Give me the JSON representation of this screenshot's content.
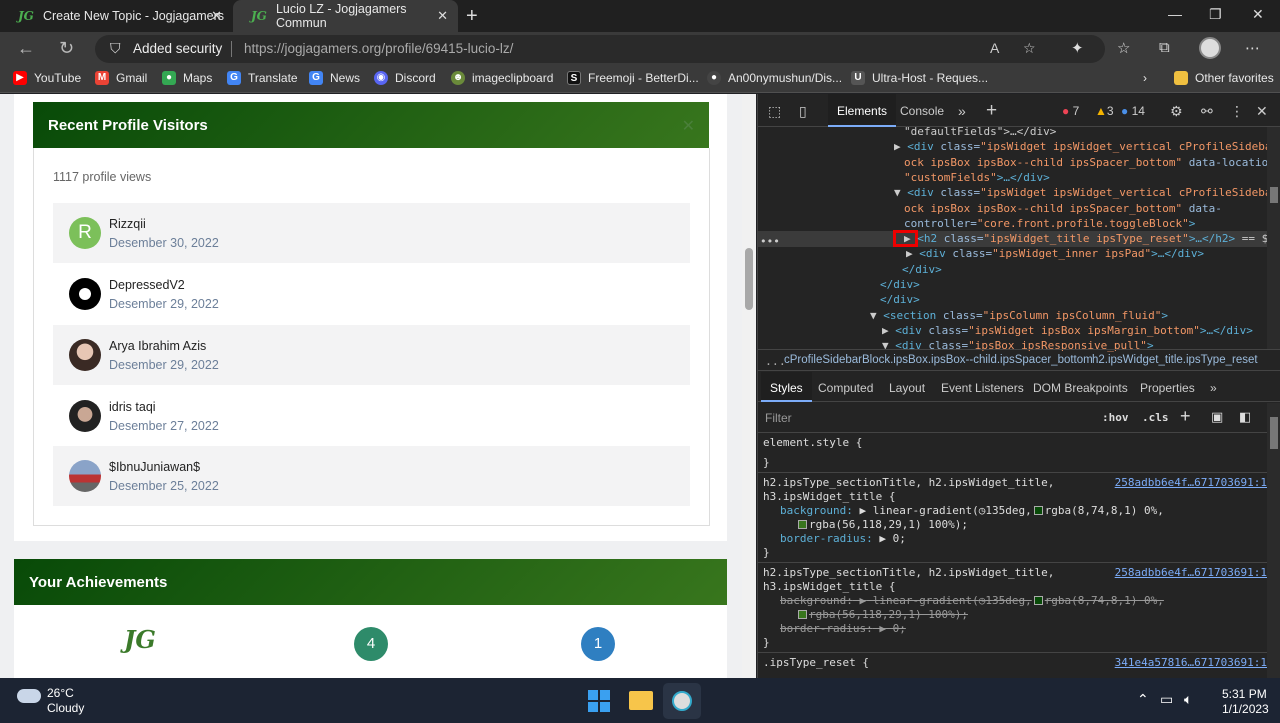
{
  "tabs": [
    {
      "favicon": "JG",
      "title": "Create New Topic - Jogjagamers"
    },
    {
      "favicon": "JG",
      "title": "Lucio LZ - Jogjagamers Commun"
    }
  ],
  "address_bar": {
    "security_label": "Added security",
    "url": "https://jogjagamers.org/profile/69415-lucio-lz/"
  },
  "bookmarks": [
    {
      "label": "YouTube",
      "color": "#ff0000"
    },
    {
      "label": "Gmail",
      "color": "#ea4335"
    },
    {
      "label": "Maps",
      "color": "#34a853"
    },
    {
      "label": "Translate",
      "color": "#4285f4"
    },
    {
      "label": "News",
      "color": "#4285f4"
    },
    {
      "label": "Discord",
      "color": "#5865f2"
    },
    {
      "label": "imageclipboard",
      "color": "#6a8a3a"
    },
    {
      "label": "Freemoji - BetterDi...",
      "color": "#111111"
    },
    {
      "label": "An00nymushun/Dis...",
      "color": "#444444"
    },
    {
      "label": "Ultra-Host - Reques...",
      "color": "#555555"
    }
  ],
  "bookmarks_other": "Other favorites",
  "visitors": {
    "title": "Recent Profile Visitors",
    "views": "1117 profile views",
    "items": [
      {
        "initial": "R",
        "name": "Rizzqii",
        "date": "Desember 30, 2022"
      },
      {
        "initial": "",
        "name": "DepressedV2",
        "date": "Desember 29, 2022"
      },
      {
        "initial": "",
        "name": "Arya Ibrahim Azis",
        "date": "Desember 29, 2022"
      },
      {
        "initial": "",
        "name": "idris taqi",
        "date": "Desember 27, 2022"
      },
      {
        "initial": "",
        "name": "$IbnuJuniawan$",
        "date": "Desember 25, 2022"
      }
    ]
  },
  "achievements": {
    "title": "Your Achievements",
    "logo": "JG",
    "badges": [
      "4",
      "1"
    ],
    "badge_colors": [
      "#2e8b6a",
      "#2f7fc1"
    ]
  },
  "devtools": {
    "tabs": [
      "Elements",
      "Console"
    ],
    "errors": "7",
    "warnings": "3",
    "issues": "14",
    "dom_lines": [
      {
        "parts": [
          [
            "tx",
            "\"defaultFields\">…</div>"
          ]
        ]
      },
      {
        "parts": [
          [
            "tx",
            "▶ "
          ],
          [
            "tg",
            "<div "
          ],
          [
            "at",
            "class="
          ],
          [
            "av2",
            "\"ipsWidget ipsWidget_vertical cProfileSidebarBl"
          ]
        ]
      },
      {
        "parts": [
          [
            "av2",
            "ock ipsBox ipsBox--child ipsSpacer_bottom\" "
          ],
          [
            "at",
            "data-location="
          ]
        ]
      },
      {
        "parts": [
          [
            "av2",
            "\"customFields\""
          ],
          [
            "tg",
            ">…</div>"
          ]
        ]
      },
      {
        "parts": [
          [
            "tx",
            "▼ "
          ],
          [
            "tg",
            "<div "
          ],
          [
            "at",
            "class="
          ],
          [
            "av2",
            "\"ipsWidget ipsWidget_vertical cProfileSidebarBl"
          ]
        ]
      },
      {
        "parts": [
          [
            "av2",
            "ock ipsBox ipsBox--child ipsSpacer_bottom\" "
          ],
          [
            "at",
            "data-"
          ]
        ]
      },
      {
        "parts": [
          [
            "at",
            "controller="
          ],
          [
            "av2",
            "\"core.front.profile.toggleBlock\""
          ],
          [
            "tg",
            ">"
          ]
        ]
      },
      {
        "parts": [
          [
            "tx",
            "▶ "
          ],
          [
            "tg",
            "<h2 "
          ],
          [
            "at",
            "class="
          ],
          [
            "av2",
            "\"ipsWidget_title ipsType_reset\""
          ],
          [
            "tg",
            ">…</h2>"
          ],
          [
            "tx",
            " == $0"
          ]
        ]
      },
      {
        "parts": [
          [
            "tx",
            "▶ "
          ],
          [
            "tg",
            "<div "
          ],
          [
            "at",
            "class="
          ],
          [
            "av2",
            "\"ipsWidget_inner ipsPad\""
          ],
          [
            "tg",
            ">…</div>"
          ]
        ]
      },
      {
        "parts": [
          [
            "tg",
            "</div>"
          ]
        ]
      },
      {
        "parts": [
          [
            "tg",
            "</div>"
          ]
        ]
      },
      {
        "parts": [
          [
            "tg",
            "</div>"
          ]
        ]
      },
      {
        "parts": [
          [
            "tx",
            "▼ "
          ],
          [
            "tg",
            "<section "
          ],
          [
            "at",
            "class="
          ],
          [
            "av2",
            "\"ipsColumn ipsColumn_fluid\""
          ],
          [
            "tg",
            ">"
          ]
        ]
      },
      {
        "parts": [
          [
            "tx",
            "▶ "
          ],
          [
            "tg",
            "<div "
          ],
          [
            "at",
            "class="
          ],
          [
            "av2",
            "\"ipsWidget ipsBox ipsMargin_bottom\""
          ],
          [
            "tg",
            ">…</div>"
          ]
        ]
      },
      {
        "parts": [
          [
            "tx",
            "▼ "
          ],
          [
            "tg",
            "<div "
          ],
          [
            "at",
            "class="
          ],
          [
            "av2",
            "\"ipsBox ipsResponsive_pull\""
          ],
          [
            "tg",
            ">"
          ]
        ]
      }
    ],
    "breadcrumbs": [
      "...",
      "cProfileSidebarBlock.ipsBox.ipsBox--child.ipsSpacer_bottom",
      "h2.ipsWidget_title.ipsType_reset"
    ],
    "subtabs": [
      "Styles",
      "Computed",
      "Layout",
      "Event Listeners",
      "DOM Breakpoints",
      "Properties"
    ],
    "filter_placeholder": "Filter",
    "hov": ":hov",
    "cls": ".cls",
    "element_style": "element.style {",
    "close_brace": "}",
    "rule1_selector_1": "h2.ipsType_sectionTitle, h2.ipsWidget_title,",
    "rule1_selector_2": "h3.ipsWidget_title {",
    "rule1_link": "258adbb6e4f…671703691:1",
    "bg_prop": "background:",
    "bg_val_a": " linear-gradient(",
    "bg_val_b": "135deg,",
    "bg_val_c": "rgba(8,74,8,1) 0%,",
    "bg_val_d": "rgba(56,118,29,1) 100%);",
    "radius_prop": "border-radius:",
    "radius_val": " 0;",
    "rule3_selector": ".ipsType_reset {",
    "rule3_link": "341e4a57816…671703691:1",
    "swatch_1": "#084a08",
    "swatch_2": "#38761d"
  },
  "taskbar": {
    "temp": "26°C",
    "weather": "Cloudy",
    "time": "5:31 PM",
    "date": "1/1/2023"
  }
}
